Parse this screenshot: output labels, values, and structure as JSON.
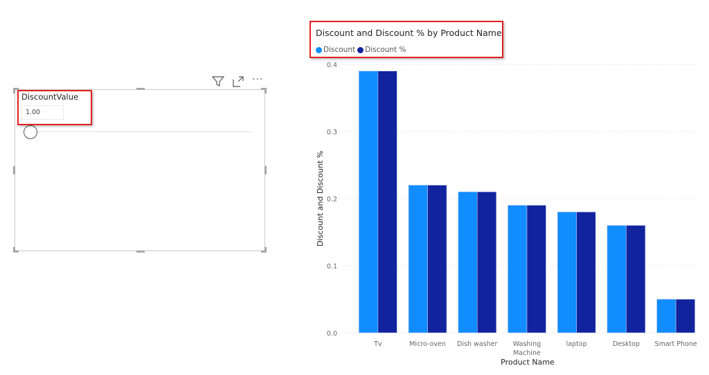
{
  "slicer": {
    "title": "DiscountValue",
    "value": "1.00",
    "slider_fraction": 0.0,
    "header_icons": [
      "filter-icon",
      "focus-mode-icon",
      "more-options-icon"
    ]
  },
  "colors": {
    "discount": "#118DFF",
    "discount_pct": "#12239E",
    "highlight": "#E02020"
  },
  "chart_data": {
    "type": "bar",
    "title": "Discount and Discount % by Product Name",
    "xlabel": "Product Name",
    "ylabel": "Discount and Discount %",
    "categories": [
      "Tv",
      "Micro-oven",
      "Dish washer",
      "Washing Machine",
      "laptop",
      "Desktop",
      "Smart Phone"
    ],
    "series": [
      {
        "name": "Discount",
        "values": [
          0.39,
          0.22,
          0.21,
          0.19,
          0.18,
          0.16,
          0.05
        ]
      },
      {
        "name": "Discount %",
        "values": [
          0.39,
          0.22,
          0.21,
          0.19,
          0.18,
          0.16,
          0.05
        ]
      }
    ],
    "ylim": [
      0,
      0.4
    ],
    "yticks": [
      "0.0",
      "0.1",
      "0.2",
      "0.3",
      "0.4"
    ],
    "grid": true,
    "legend_position": "top-left"
  }
}
